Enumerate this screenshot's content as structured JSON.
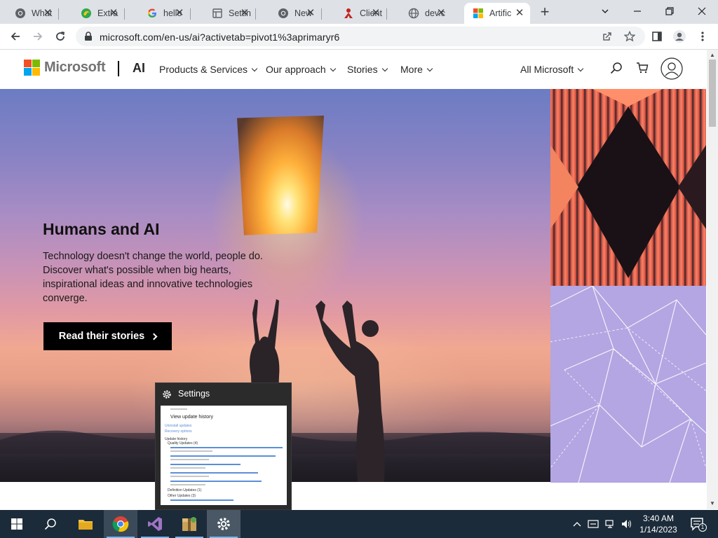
{
  "browser": {
    "tabs": [
      {
        "title": "What",
        "icon": "chrome-icon"
      },
      {
        "title": "Extra",
        "icon": "edge-icon"
      },
      {
        "title": "hello",
        "icon": "google-icon"
      },
      {
        "title": "Settin",
        "icon": "settings-doc-icon"
      },
      {
        "title": "New",
        "icon": "chrome-icon"
      },
      {
        "title": "Client",
        "icon": "client-icon"
      },
      {
        "title": "dev.c",
        "icon": "globe-icon"
      },
      {
        "title": "Artific",
        "icon": "microsoft-icon"
      }
    ],
    "active_tab_index": 7,
    "new_tab_label": "+",
    "url": "microsoft.com/en-us/ai?activetab=pivot1%3aprimaryr6"
  },
  "header": {
    "brand": "Microsoft",
    "section": "AI",
    "nav": [
      {
        "label": "Products & Services"
      },
      {
        "label": "Our approach"
      },
      {
        "label": "Stories"
      },
      {
        "label": "More"
      }
    ],
    "all_microsoft": "All Microsoft"
  },
  "hero": {
    "title": "Humans and AI",
    "body": "Technology doesn't change the world, people do. Discover what's possible when big hearts, inspirational ideas and innovative technologies converge.",
    "cta": "Read their stories"
  },
  "preview": {
    "title": "Settings",
    "window_header": "View update history",
    "lines": [
      "Uninstall updates",
      "Recovery options",
      "Update history",
      "Quality Updates (4)",
      "Definition Updates (1)",
      "Other Updates (3)"
    ]
  },
  "taskbar": {
    "time": "3:40 AM",
    "date": "1/14/2023",
    "notification_count": "1"
  },
  "colors": {
    "ms_red": "#f25022",
    "ms_green": "#7fba00",
    "ms_blue": "#00a4ef",
    "ms_yellow": "#ffb900",
    "taskbar": "#1b2b3a",
    "cta": "#000000"
  }
}
